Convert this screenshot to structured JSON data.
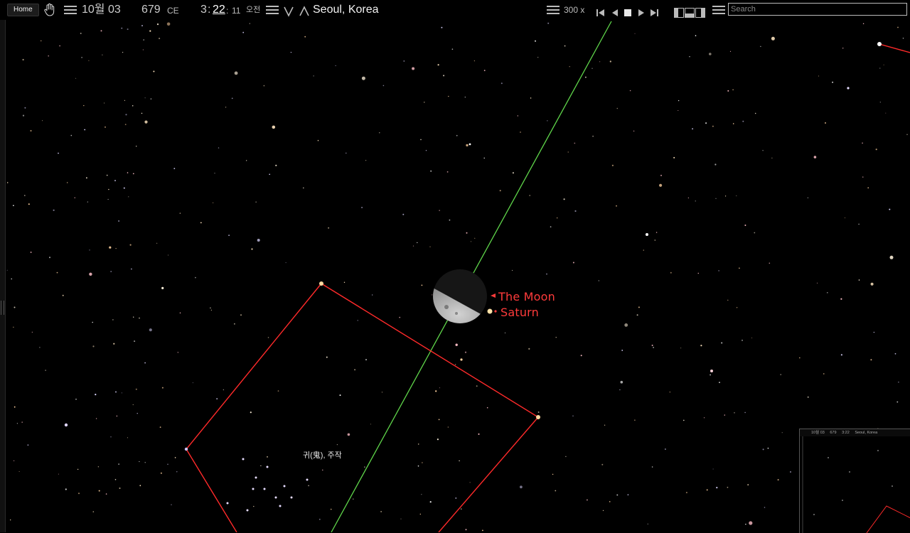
{
  "toolbar": {
    "home_label": "Home",
    "month_day": "10월 03",
    "year": "679",
    "era": "CE",
    "hour": "3",
    "minute": "22",
    "second": "11",
    "ampm": "오전",
    "location": "Seoul, Korea",
    "speed": "300 x",
    "search_placeholder": "Search"
  },
  "sky": {
    "moon_label": "The Moon",
    "planet_label": "Saturn",
    "constellation_label": "귀(鬼), 주작",
    "colors": {
      "background": "#000000",
      "label": "#ff3b3b",
      "constellation_line": "#ff2a2a",
      "ecliptic_line": "#5fd54a"
    }
  },
  "mini_view": {
    "month_day": "10월 03",
    "year": "679",
    "time": "3:22",
    "location": "Seoul, Korea"
  }
}
